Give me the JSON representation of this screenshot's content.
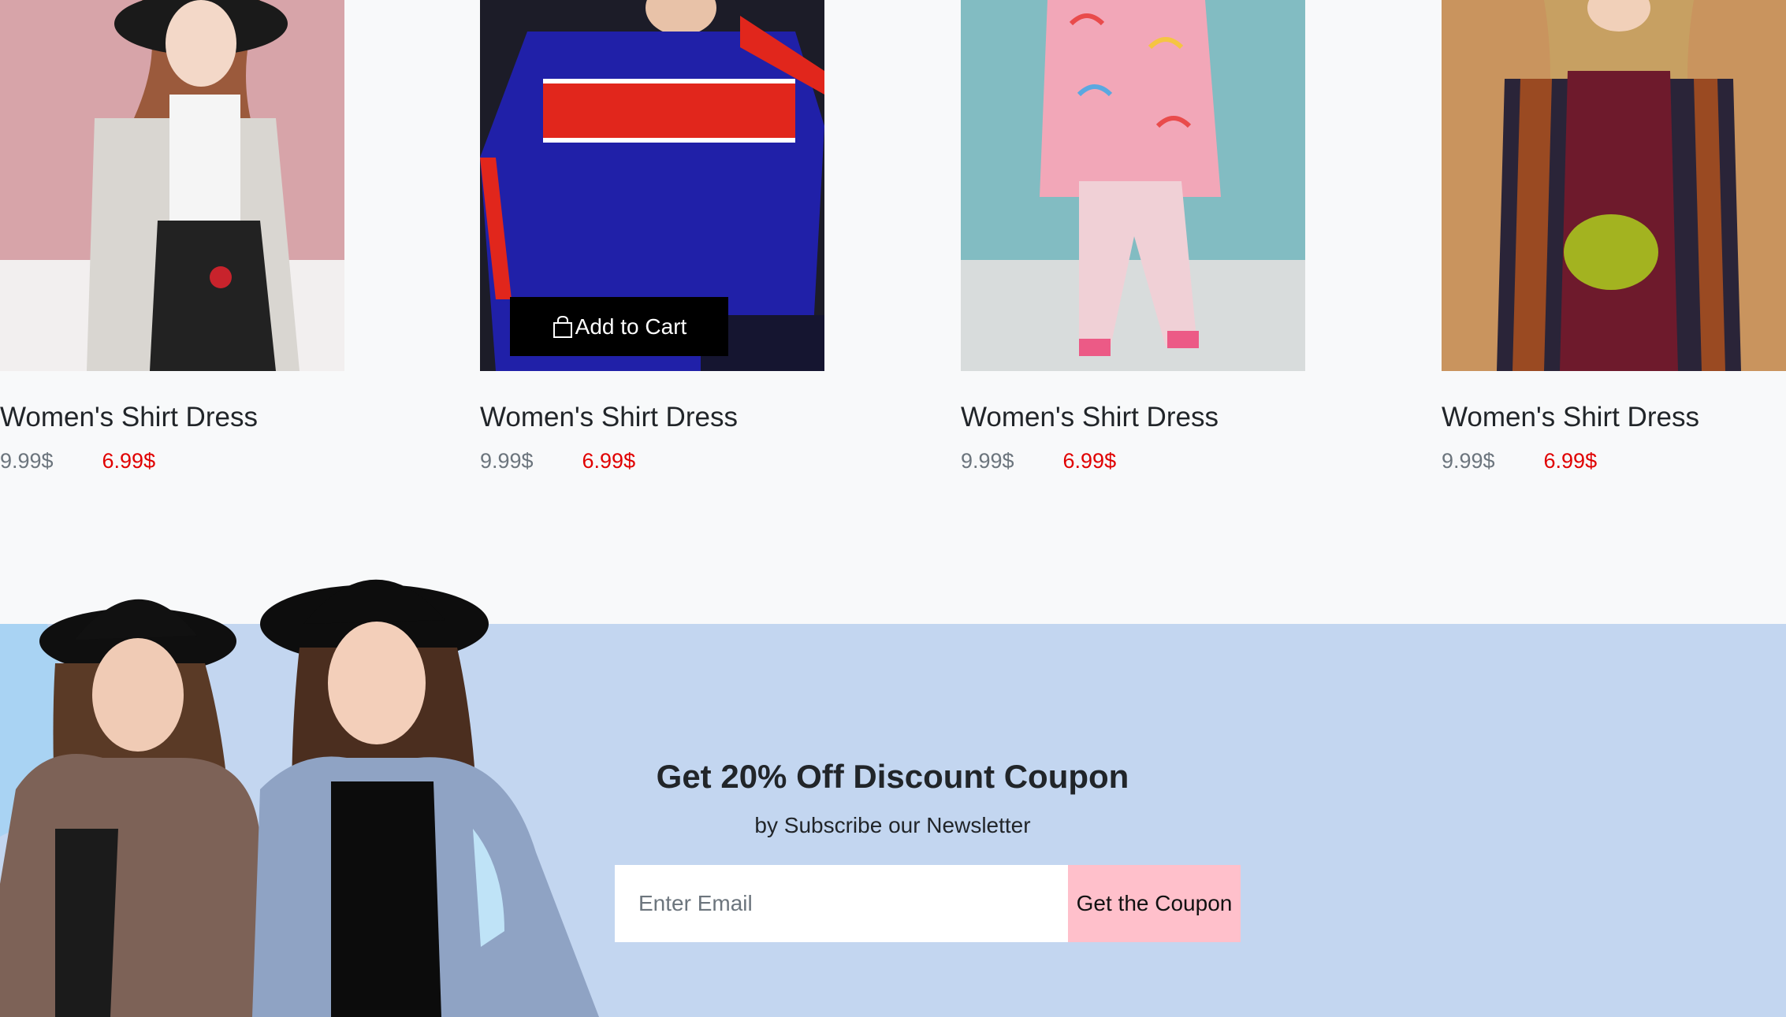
{
  "products": [
    {
      "title": "Women's Shirt Dress",
      "old_price": "9.99$",
      "new_price": "6.99$"
    },
    {
      "title": "Women's Shirt Dress",
      "old_price": "9.99$",
      "new_price": "6.99$",
      "cart_label": "Add to Cart"
    },
    {
      "title": "Women's Shirt Dress",
      "old_price": "9.99$",
      "new_price": "6.99$"
    },
    {
      "title": "Women's Shirt Dress",
      "old_price": "9.99$",
      "new_price": "6.99$"
    }
  ],
  "newsletter": {
    "title": "Get 20% Off Discount Coupon",
    "subtitle": "by Subscribe our Newsletter",
    "email_placeholder": "Enter Email",
    "button_label": "Get the Coupon"
  },
  "colors": {
    "page_bg": "#f8f9fa",
    "newsletter_bg": "#c3d6f0",
    "sale_price": "#e00000",
    "old_price": "#6c757d",
    "button_bg": "#ffc0cb",
    "cart_button_bg": "#000000"
  },
  "icons": {
    "cart": "shopping-bag-icon"
  }
}
